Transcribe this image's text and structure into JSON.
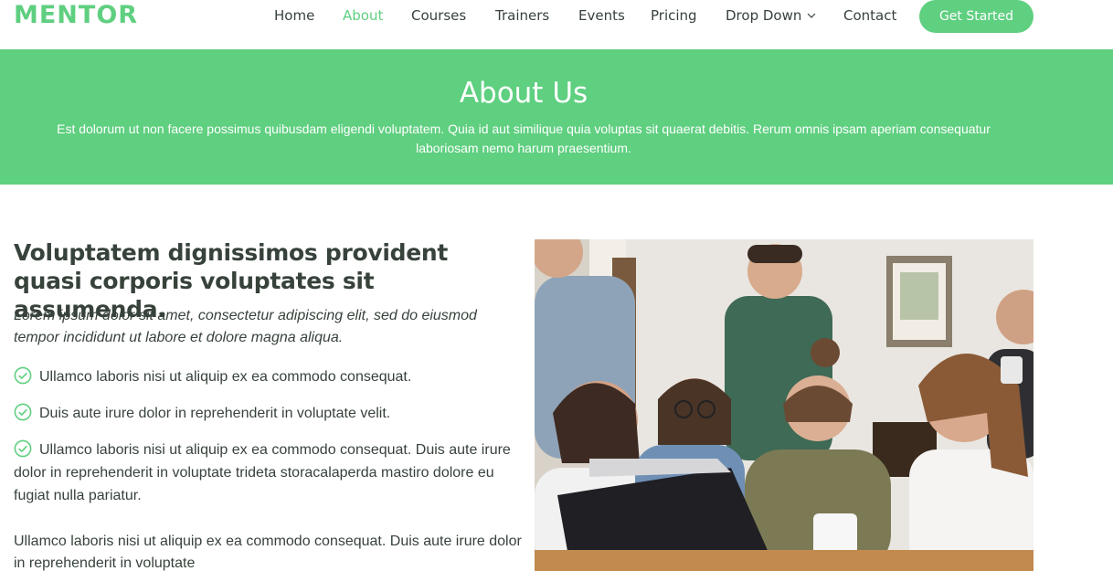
{
  "header": {
    "logo": "MENTOR",
    "nav": [
      {
        "label": "Home",
        "active": false
      },
      {
        "label": "About",
        "active": true
      },
      {
        "label": "Courses",
        "active": false
      },
      {
        "label": "Trainers",
        "active": false
      },
      {
        "label": "Events",
        "active": false
      },
      {
        "label": "Pricing",
        "active": false
      },
      {
        "label": "Drop Down",
        "active": false
      },
      {
        "label": "Contact",
        "active": false
      }
    ],
    "cta_label": "Get Started"
  },
  "banner": {
    "title": "About Us",
    "text": "Est dolorum ut non facere possimus quibusdam eligendi voluptatem. Quia id aut similique quia voluptas sit quaerat debitis. Rerum omnis ipsam aperiam consequatur laboriosam nemo harum praesentium."
  },
  "content": {
    "title": "Voluptatem dignissimos provident quasi corporis voluptates sit assumenda.",
    "lead": "Lorem ipsum dolor sit amet, consectetur adipiscing elit, sed do eiusmod tempor incididunt ut labore et dolore magna aliqua.",
    "list": [
      "Ullamco laboris nisi ut aliquip ex ea commodo consequat.",
      "Duis aute irure dolor in reprehenderit in voluptate velit.",
      "Ullamco laboris nisi ut aliquip ex ea commodo consequat. Duis aute irure dolor in reprehenderit in voluptate trideta storacalaperda mastiro dolore eu fugiat nulla pariatur."
    ],
    "paragraph": "Ullamco laboris nisi ut aliquip ex ea commodo consequat. Duis aute irure dolor in reprehenderit in voluptate"
  },
  "icons": {
    "dropdown": "chevron-down-icon",
    "check": "check-circle-icon"
  },
  "colors": {
    "accent": "#5fcf80",
    "text": "#37423b",
    "white": "#ffffff"
  }
}
